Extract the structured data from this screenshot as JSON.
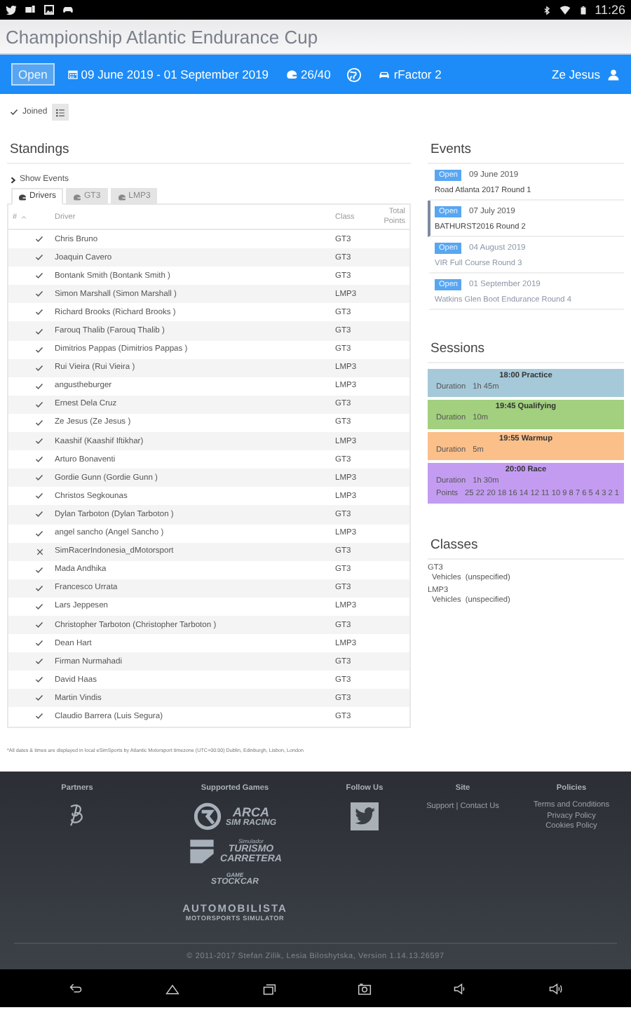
{
  "status_bar": {
    "time": "11:26"
  },
  "header": {
    "title": "Championship Atlantic Endurance Cup"
  },
  "info_bar": {
    "status": "Open",
    "dates": "09 June 2019 - 01 September 2019",
    "slots": "26/40",
    "game": "rFactor 2",
    "user": "Ze Jesus"
  },
  "membership": {
    "label": "Joined",
    "checked": true
  },
  "standings": {
    "title": "Standings",
    "toggle": "Show Events",
    "tabs": [
      {
        "label": "Drivers",
        "selected": true
      },
      {
        "label": "GT3",
        "selected": false
      },
      {
        "label": "LMP3",
        "selected": false
      }
    ],
    "columns": [
      "#",
      "Driver",
      "Class",
      "Total Points"
    ],
    "rows": [
      {
        "driver": "Chris Bruno",
        "class": "GT3",
        "joined": true
      },
      {
        "driver": "Joaquin Cavero",
        "class": "GT3",
        "joined": true
      },
      {
        "driver": "Bontank Smith (Bontank Smith )",
        "class": "GT3",
        "joined": true
      },
      {
        "driver": "Simon Marshall (Simon Marshall )",
        "class": "LMP3",
        "joined": true
      },
      {
        "driver": "Richard Brooks (Richard Brooks )",
        "class": "GT3",
        "joined": true
      },
      {
        "driver": "Farouq Thalib (Farouq Thalib )",
        "class": "GT3",
        "joined": true
      },
      {
        "driver": "Dimitrios Pappas (Dimitrios Pappas )",
        "class": "GT3",
        "joined": true
      },
      {
        "driver": "Rui Vieira (Rui Vieira )",
        "class": "LMP3",
        "joined": true
      },
      {
        "driver": "angustheburger",
        "class": "LMP3",
        "joined": true
      },
      {
        "driver": "Ernest Dela Cruz",
        "class": "GT3",
        "joined": true
      },
      {
        "driver": "Ze Jesus (Ze Jesus )",
        "class": "GT3",
        "joined": true
      },
      {
        "driver": "Kaashif (Kaashif Iftikhar)",
        "class": "LMP3",
        "joined": true
      },
      {
        "driver": "Arturo Bonaventi",
        "class": "GT3",
        "joined": true
      },
      {
        "driver": "Gordie Gunn (Gordie Gunn )",
        "class": "LMP3",
        "joined": true
      },
      {
        "driver": "Christos Segkounas",
        "class": "LMP3",
        "joined": true
      },
      {
        "driver": "Dylan Tarboton (Dylan Tarboton )",
        "class": "GT3",
        "joined": true
      },
      {
        "driver": "angel sancho (Angel Sancho )",
        "class": "LMP3",
        "joined": true
      },
      {
        "driver": "SimRacerIndonesia_dMotorsport",
        "class": "GT3",
        "joined": false
      },
      {
        "driver": "Mada Andhika",
        "class": "GT3",
        "joined": true
      },
      {
        "driver": "Francesco Urrata",
        "class": "GT3",
        "joined": true
      },
      {
        "driver": "Lars Jeppesen",
        "class": "LMP3",
        "joined": true
      },
      {
        "driver": "Christopher Tarboton (Christopher Tarboton )",
        "class": "GT3",
        "joined": true
      },
      {
        "driver": "Dean Hart",
        "class": "LMP3",
        "joined": true
      },
      {
        "driver": "Firman Nurmahadi",
        "class": "GT3",
        "joined": true
      },
      {
        "driver": "David Haas",
        "class": "GT3",
        "joined": true
      },
      {
        "driver": "Martin Vindis",
        "class": "GT3",
        "joined": true
      },
      {
        "driver": "Claudio Barrera (Luis Segura)",
        "class": "GT3",
        "joined": true
      }
    ]
  },
  "footnote": "*All dates & times are displayed in local eSimSports by Atlantic Motorsport timezone (UTC+00:00) Dublin, Edinburgh, Lisbon, London",
  "events": {
    "title": "Events",
    "items": [
      {
        "status": "Open",
        "date": "09 June 2019",
        "name": "Road Atlanta 2017 Round 1",
        "selected": false,
        "dimmed": false
      },
      {
        "status": "Open",
        "date": "07 July 2019",
        "name": "BATHURST2016 Round 2",
        "selected": true,
        "dimmed": false
      },
      {
        "status": "Open",
        "date": "04 August 2019",
        "name": "VIR Full Course Round 3",
        "selected": false,
        "dimmed": true
      },
      {
        "status": "Open",
        "date": "01 September 2019",
        "name": "Watkins Glen Boot Endurance Round 4",
        "selected": false,
        "dimmed": true
      }
    ]
  },
  "sessions": {
    "title": "Sessions",
    "items": [
      {
        "title": "18:00 Practice",
        "color": "#a6c9d9",
        "details": [
          {
            "label": "Duration",
            "value": "1h 45m"
          }
        ]
      },
      {
        "title": "19:45 Qualifying",
        "color": "#a2d07e",
        "details": [
          {
            "label": "Duration",
            "value": "10m"
          }
        ]
      },
      {
        "title": "19:55 Warmup",
        "color": "#fbbf8a",
        "details": [
          {
            "label": "Duration",
            "value": "5m"
          }
        ]
      },
      {
        "title": "20:00 Race",
        "color": "#c39cf2",
        "details": [
          {
            "label": "Duration",
            "value": "1h 30m"
          },
          {
            "label": "Points",
            "value": "25 22 20 18 16 14 12 11 10 9 8 7 6 5 4 3 2 1"
          }
        ]
      }
    ]
  },
  "classes": {
    "title": "Classes",
    "items": [
      {
        "name": "GT3",
        "label": "Vehicles",
        "value": "(unspecified)"
      },
      {
        "name": "LMP3",
        "label": "Vehicles",
        "value": "(unspecified)"
      }
    ]
  },
  "footer": {
    "partners": "Partners",
    "games_title": "Supported Games",
    "games": [
      {
        "lines": [
          "ARCA",
          "SIM RACING"
        ]
      },
      {
        "lines": [
          "Simulador",
          "TURISMO",
          "CARRETERA"
        ]
      },
      {
        "lines": [
          "GAME",
          "STOCKCAR"
        ]
      },
      {
        "lines": [
          "AUTOMOBILISTA",
          "MOTORSPORTS SIMULATOR"
        ]
      }
    ],
    "follow": "Follow Us",
    "site": "Site",
    "site_links": [
      "Support | Contact Us"
    ],
    "policies": "Policies",
    "policy_links": [
      "Terms and Conditions",
      "Privacy Policy",
      "Cookies Policy"
    ],
    "copyright": "© 2011-2017 Stefan Zilik, Lesia Biloshytska, Version 1.14.13.26597"
  }
}
